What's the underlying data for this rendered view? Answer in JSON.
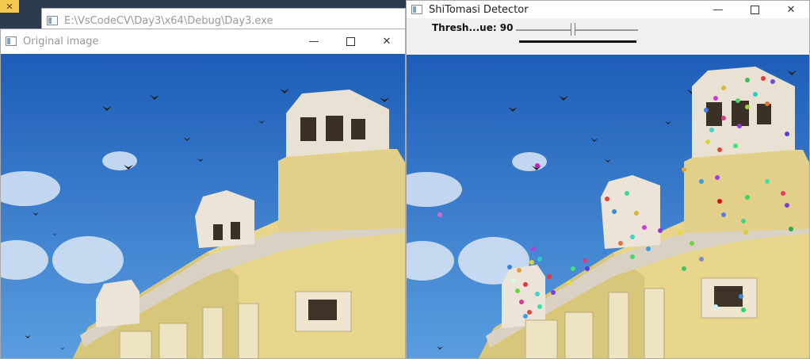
{
  "background_window": {
    "title": "E:\\VsCodeCV\\Day3\\x64\\Debug\\Day3.exe",
    "close_glyph": "✕"
  },
  "original_window": {
    "title": "Original image",
    "minimize_glyph": "—",
    "close_glyph": "✕"
  },
  "detector_window": {
    "title": "ShiTomasi Detector",
    "minimize_glyph": "—",
    "close_glyph": "✕",
    "trackbar_label": "Thresh...ue: 90",
    "trackbar_value": 90
  },
  "colors": {
    "sky_top": "#1d5db8",
    "sky_bottom": "#5a9ee0",
    "building": "#e6d58a",
    "building_shadow": "#b8a66a",
    "trim": "#d9d2c4"
  }
}
